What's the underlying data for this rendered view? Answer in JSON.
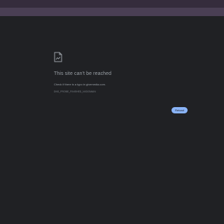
{
  "error": {
    "title": "This site can't be reached",
    "detail": "Check if there is a typo in givemedia.com.",
    "code": "DNS_PROBE_FINISHED_NXDOMAIN"
  },
  "actions": {
    "reload_label": "Reload"
  },
  "icons": {
    "page_icon": "broken-document-icon"
  },
  "colors": {
    "title_bar": "#352c3c",
    "toolbar": "#4a3f54",
    "page_background": "#202124",
    "text": "#9aa0a6",
    "accent_button": "#8ab4f8"
  }
}
